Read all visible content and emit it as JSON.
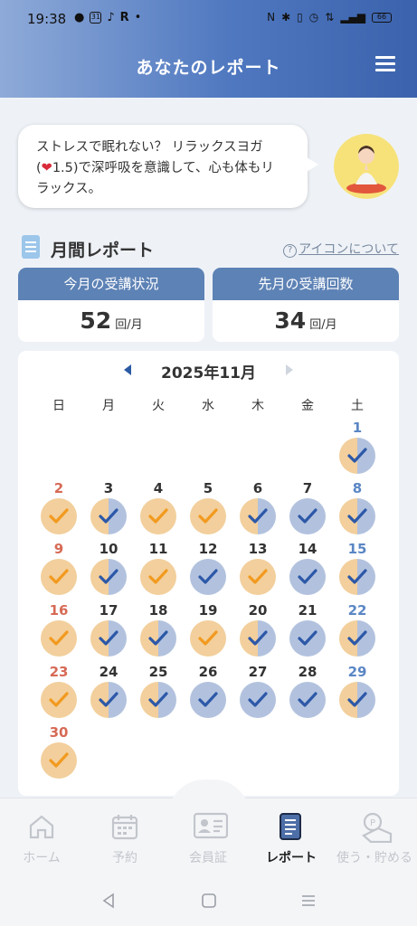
{
  "status_bar": {
    "time": "19:38",
    "left_icons": [
      "line-icon",
      "calendar-31-icon",
      "tiktok-icon",
      "rakuten-r-icon",
      "dot-icon"
    ],
    "right_icons": [
      "nfc-icon",
      "bluetooth-icon",
      "vibrate-icon",
      "alarm-icon",
      "data-icon",
      "signal-icon",
      "battery-icon"
    ],
    "calendar_badge": "31",
    "r_letter": "R",
    "dot": "•",
    "battery_level": "66"
  },
  "header": {
    "title": "あなたのレポート",
    "menu_icon": "hamburger-menu-icon"
  },
  "bubble": {
    "line1": "ストレスで眠れない？ リラックスヨガ",
    "line2_pre": "(",
    "heart": "❤",
    "line2_post": "1.5)で深呼吸を意識して、心も体もリ",
    "line3": "ラックス。"
  },
  "report": {
    "title": "月間レポート",
    "about_link": "アイコンについて",
    "about_icon": "question-circle-icon"
  },
  "cards": {
    "this_month": {
      "label": "今月の受講状況",
      "value": "52",
      "unit": "回/月"
    },
    "last_month": {
      "label": "先月の受講回数",
      "value": "34",
      "unit": "回/月"
    }
  },
  "calendar": {
    "month_label": "2025年11月",
    "weekdays": [
      "日",
      "月",
      "火",
      "水",
      "木",
      "金",
      "土"
    ],
    "colors": {
      "orange": "#f2cf9c",
      "blue": "#b2c2de",
      "check_orange": "#f29a1f",
      "check_blue": "#2d58a8"
    },
    "weeks": [
      [
        null,
        null,
        null,
        null,
        null,
        null,
        {
          "d": "1",
          "m": "half"
        }
      ],
      [
        {
          "d": "2",
          "m": "full"
        },
        {
          "d": "3",
          "m": "half"
        },
        {
          "d": "4",
          "m": "full"
        },
        {
          "d": "5",
          "m": "full"
        },
        {
          "d": "6",
          "m": "half"
        },
        {
          "d": "7",
          "m": "blue"
        },
        {
          "d": "8",
          "m": "half"
        }
      ],
      [
        {
          "d": "9",
          "m": "full"
        },
        {
          "d": "10",
          "m": "half"
        },
        {
          "d": "11",
          "m": "full"
        },
        {
          "d": "12",
          "m": "blue"
        },
        {
          "d": "13",
          "m": "full"
        },
        {
          "d": "14",
          "m": "blue"
        },
        {
          "d": "15",
          "m": "half"
        }
      ],
      [
        {
          "d": "16",
          "m": "full"
        },
        {
          "d": "17",
          "m": "half"
        },
        {
          "d": "18",
          "m": "half"
        },
        {
          "d": "19",
          "m": "full"
        },
        {
          "d": "20",
          "m": "half"
        },
        {
          "d": "21",
          "m": "blue"
        },
        {
          "d": "22",
          "m": "half"
        }
      ],
      [
        {
          "d": "23",
          "m": "full"
        },
        {
          "d": "24",
          "m": "half"
        },
        {
          "d": "25",
          "m": "half"
        },
        {
          "d": "26",
          "m": "blue"
        },
        {
          "d": "27",
          "m": "blue"
        },
        {
          "d": "28",
          "m": "blue"
        },
        {
          "d": "29",
          "m": "half"
        }
      ],
      [
        {
          "d": "30",
          "m": "full"
        },
        null,
        null,
        null,
        null,
        null,
        null
      ]
    ]
  },
  "bottom_nav": [
    {
      "label": "ホーム",
      "icon": "home-icon",
      "active": false
    },
    {
      "label": "予約",
      "icon": "calendar-icon",
      "active": false
    },
    {
      "label": "会員証",
      "icon": "member-card-icon",
      "active": false
    },
    {
      "label": "レポート",
      "icon": "report-icon",
      "active": true
    },
    {
      "label": "使う・貯める",
      "icon": "points-icon",
      "active": false
    }
  ],
  "system_nav": [
    "back-icon",
    "home-square-icon",
    "recents-icon"
  ]
}
